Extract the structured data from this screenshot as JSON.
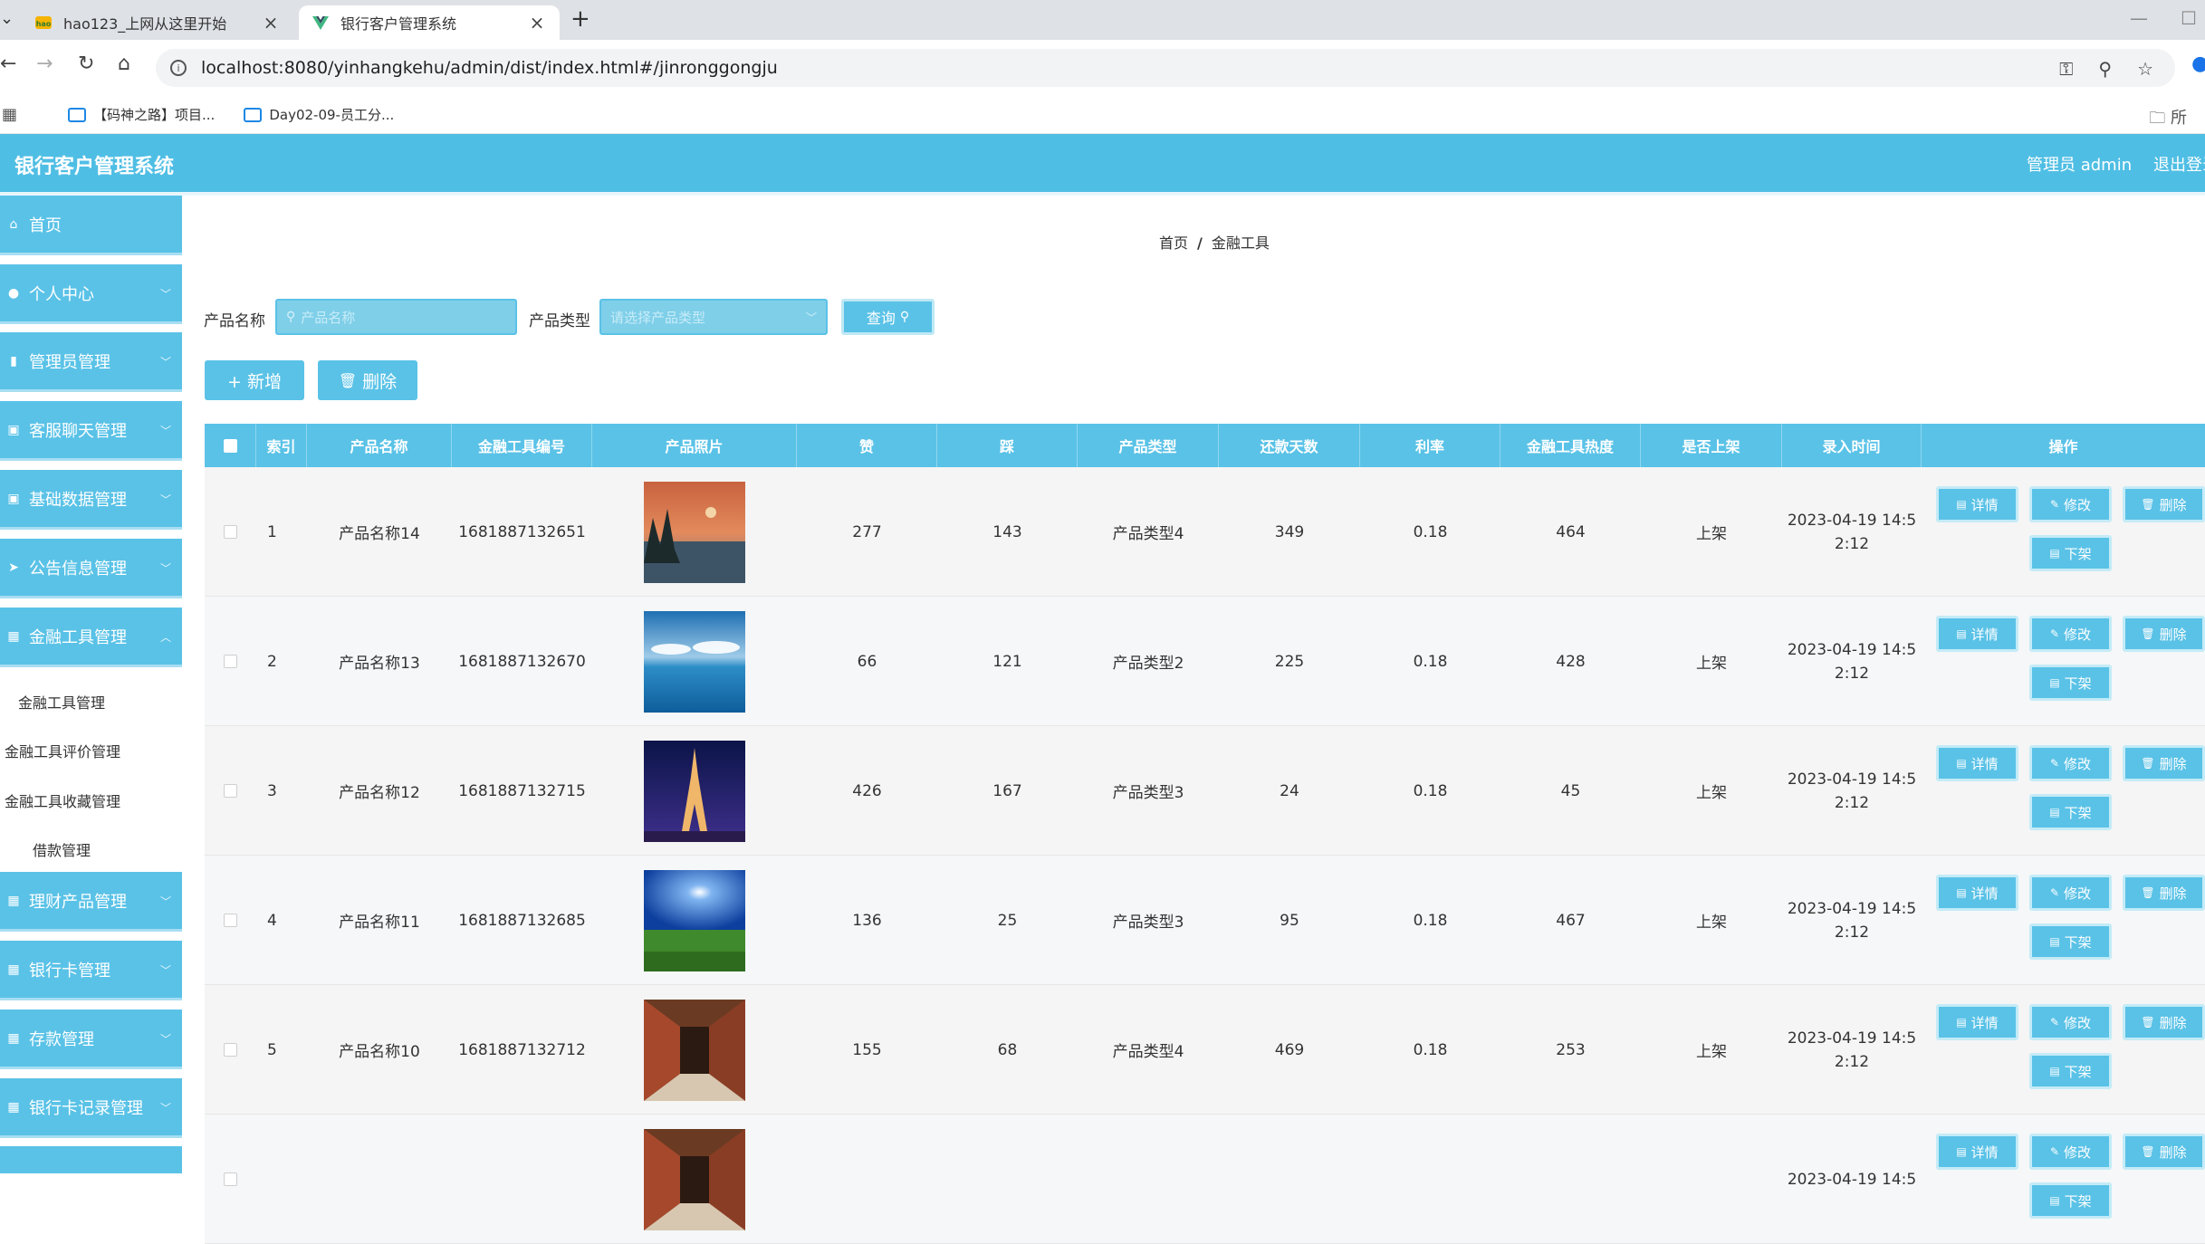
{
  "browser": {
    "tabs": [
      {
        "title": "hao123_上网从这里开始",
        "active": false
      },
      {
        "title": "银行客户管理系统",
        "active": true
      }
    ],
    "close_glyph": "×",
    "new_tab_glyph": "+",
    "url": "localhost:8080/yinhangkehu/admin/dist/index.html#/jinronggongju",
    "bookmarks": [
      "【码神之路】项目...",
      "Day02-09-员工分..."
    ],
    "bookmark_folder_label": "所"
  },
  "header": {
    "title": "银行客户管理系统",
    "user": "管理员 admin",
    "logout": "退出登录"
  },
  "sidebar": {
    "menus": [
      {
        "label": "首页",
        "icon": "home-icon",
        "has_chevron": false
      },
      {
        "label": "个人中心",
        "icon": "user-icon",
        "has_chevron": true
      },
      {
        "label": "管理员管理",
        "icon": "bar-chart-icon",
        "has_chevron": true
      },
      {
        "label": "客服聊天管理",
        "icon": "briefcase-icon",
        "has_chevron": true
      },
      {
        "label": "基础数据管理",
        "icon": "briefcase-icon",
        "has_chevron": true
      },
      {
        "label": "公告信息管理",
        "icon": "send-icon",
        "has_chevron": true
      },
      {
        "label": "金融工具管理",
        "icon": "grid-icon",
        "has_chevron": true
      },
      {
        "label": "理财产品管理",
        "icon": "grid-icon",
        "has_chevron": true
      },
      {
        "label": "银行卡管理",
        "icon": "grid-icon",
        "has_chevron": true
      },
      {
        "label": "存款管理",
        "icon": "grid-icon",
        "has_chevron": true
      },
      {
        "label": "银行卡记录管理",
        "icon": "grid-icon",
        "has_chevron": true
      }
    ],
    "submenu": [
      "金融工具管理",
      "金融工具评价管理",
      "金融工具收藏管理",
      "借款管理"
    ]
  },
  "breadcrumb": {
    "home": "首页",
    "separator": "/",
    "current": "金融工具"
  },
  "filters": {
    "name_label": "产品名称",
    "name_placeholder": "产品名称",
    "type_label": "产品类型",
    "type_placeholder": "请选择产品类型",
    "query_button": "查询"
  },
  "actions": {
    "add": "+ 新增",
    "delete": "删除"
  },
  "table": {
    "columns": [
      "",
      "索引",
      "产品名称",
      "金融工具编号",
      "产品照片",
      "赞",
      "踩",
      "产品类型",
      "还款天数",
      "利率",
      "金融工具热度",
      "是否上架",
      "录入时间",
      "操作"
    ],
    "row_buttons": {
      "detail": "详情",
      "edit": "修改",
      "delete": "删除",
      "offshelf": "下架"
    },
    "rows": [
      {
        "index": "1",
        "name": "产品名称14",
        "code": "1681887132651",
        "photo": "sunset-lake",
        "like": "277",
        "dislike": "143",
        "type": "产品类型4",
        "days": "349",
        "rate": "0.18",
        "heat": "464",
        "shelf": "上架",
        "time_line1": "2023-04-19 14:5",
        "time_line2": "2:12"
      },
      {
        "index": "2",
        "name": "产品名称13",
        "code": "1681887132670",
        "photo": "sky-sea",
        "like": "66",
        "dislike": "121",
        "type": "产品类型2",
        "days": "225",
        "rate": "0.18",
        "heat": "428",
        "shelf": "上架",
        "time_line1": "2023-04-19 14:5",
        "time_line2": "2:12"
      },
      {
        "index": "3",
        "name": "产品名称12",
        "code": "1681887132715",
        "photo": "eiffel-night",
        "like": "426",
        "dislike": "167",
        "type": "产品类型3",
        "days": "24",
        "rate": "0.18",
        "heat": "45",
        "shelf": "上架",
        "time_line1": "2023-04-19 14:5",
        "time_line2": "2:12"
      },
      {
        "index": "4",
        "name": "产品名称11",
        "code": "1681887132685",
        "photo": "sun-meadow",
        "like": "136",
        "dislike": "25",
        "type": "产品类型3",
        "days": "95",
        "rate": "0.18",
        "heat": "467",
        "shelf": "上架",
        "time_line1": "2023-04-19 14:5",
        "time_line2": "2:12"
      },
      {
        "index": "5",
        "name": "产品名称10",
        "code": "1681887132712",
        "photo": "corridor",
        "like": "155",
        "dislike": "68",
        "type": "产品类型4",
        "days": "469",
        "rate": "0.18",
        "heat": "253",
        "shelf": "上架",
        "time_line1": "2023-04-19 14:5",
        "time_line2": "2:12"
      },
      {
        "index": "",
        "name": "",
        "code": "",
        "photo": "corridor",
        "like": "",
        "dislike": "",
        "type": "",
        "days": "",
        "rate": "",
        "heat": "",
        "shelf": "",
        "time_line1": "2023-04-19 14:5",
        "time_line2": ""
      }
    ]
  },
  "colors": {
    "primary": "#5ac2e7",
    "header": "#4fbee4"
  }
}
